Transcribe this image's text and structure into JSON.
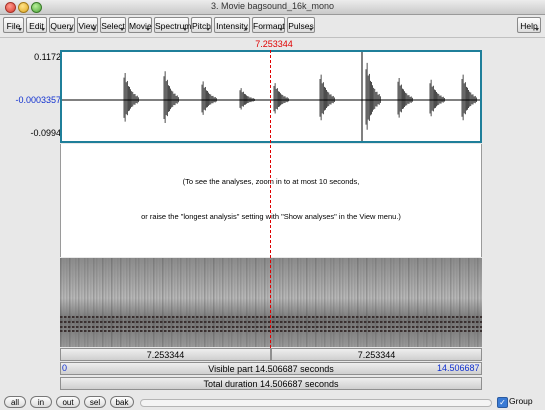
{
  "window": {
    "title": "3. Movie bagsound_16k_mono"
  },
  "menus": [
    "File",
    "Edit",
    "Query",
    "View",
    "Select",
    "Movie",
    "Spectrum",
    "Pitch",
    "Intensity",
    "Formant",
    "Pulses"
  ],
  "help_label": "Help",
  "cursor": {
    "time": "7.253344"
  },
  "waveform": {
    "y_max": "0.1172",
    "y_mid": "-0.0003357",
    "y_min": "-0.0994"
  },
  "message": {
    "line1": "(To see the analyses, zoom in to at most 10 seconds,",
    "line2": "or raise the \"longest analysis\" setting with \"Show analyses\" in the View menu.)"
  },
  "bars": {
    "left_segment": "7.253344",
    "right_segment": "7.253344",
    "visible_start": "0",
    "visible_label": "Visible part 14.506687 seconds",
    "visible_end": "14.506687",
    "total": "Total duration 14.506687 seconds"
  },
  "bottom_buttons": [
    "all",
    "in",
    "out",
    "sel",
    "bak"
  ],
  "group": {
    "label": "Group",
    "checked": true
  },
  "colors": {
    "cursor": "#e00000",
    "frame": "#1f7f9a",
    "blue_text": "#1030d0"
  }
}
